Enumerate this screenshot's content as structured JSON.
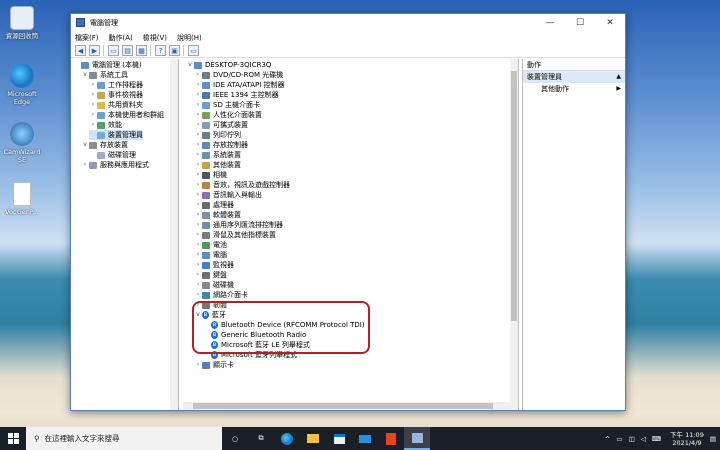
{
  "desktop": {
    "icons": [
      {
        "label": "資源回收筒",
        "icon": "recycle-bin"
      },
      {
        "label": "Microsoft Edge",
        "icon": "edge"
      },
      {
        "label": "CamWizard SE",
        "icon": "camwizard"
      },
      {
        "label": "VocGenP...",
        "icon": "file"
      }
    ]
  },
  "window": {
    "title": "電腦管理",
    "menu": [
      "檔案(F)",
      "動作(A)",
      "檢視(V)",
      "說明(H)"
    ],
    "controls": {
      "minimize": "—",
      "maximize": "☐",
      "close": "✕"
    }
  },
  "left_tree": [
    {
      "label": "電腦管理 (本機)",
      "level": 0,
      "chev": "",
      "icon": "computer"
    },
    {
      "label": "系統工具",
      "level": 1,
      "chev": "v",
      "icon": "tools"
    },
    {
      "label": "工作排程器",
      "level": 2,
      "chev": ">",
      "icon": "scheduler"
    },
    {
      "label": "事件檢視器",
      "level": 2,
      "chev": ">",
      "icon": "event"
    },
    {
      "label": "共用資料夾",
      "level": 2,
      "chev": ">",
      "icon": "folder"
    },
    {
      "label": "本機使用者和群組",
      "level": 2,
      "chev": ">",
      "icon": "users"
    },
    {
      "label": "效能",
      "level": 2,
      "chev": ">",
      "icon": "performance"
    },
    {
      "label": "裝置管理員",
      "level": 2,
      "chev": "",
      "icon": "device",
      "selected": true
    },
    {
      "label": "存放裝置",
      "level": 1,
      "chev": "v",
      "icon": "storage"
    },
    {
      "label": "磁碟管理",
      "level": 2,
      "chev": "",
      "icon": "disk"
    },
    {
      "label": "服務與應用程式",
      "level": 1,
      "chev": ">",
      "icon": "services"
    }
  ],
  "device_tree": {
    "root": "DESKTOP-3QICR3Q",
    "categories": [
      "DVD/CD-ROM 光碟機",
      "IDE ATA/ATAPI 控制器",
      "IEEE 1394 主控制器",
      "SD 主機介面卡",
      "人性化介面裝置",
      "可攜式裝置",
      "列印佇列",
      "存放控制器",
      "系統裝置",
      "其他裝置",
      "相機",
      "音效，視訊及遊戲控制器",
      "音訊輸入與輸出",
      "處理器",
      "軟體裝置",
      "通用序列匯流排控制器",
      "滑鼠及其他指標裝置",
      "電池",
      "電腦",
      "監視器",
      "鍵盤",
      "磁碟機",
      "網路介面卡",
      "韌體"
    ],
    "bluetooth": {
      "label": "藍牙",
      "children": [
        "Bluetooth Device (RFCOMM Protocol TDI)",
        "Generic Bluetooth Radio",
        "Microsoft 藍牙 LE 列舉程式",
        "Microsoft 藍牙列舉程式"
      ]
    },
    "after": [
      "顯示卡"
    ]
  },
  "actions": {
    "header": "動作",
    "section": "裝置管理員",
    "items": [
      "其他動作"
    ]
  },
  "taskbar": {
    "search_placeholder": "在這裡輸入文字來搜尋",
    "time": "下午 11:09",
    "date": "2021/4/9"
  },
  "colors": {
    "accent": "#1f6fd1",
    "highlight_border": "#b4202a",
    "selected": "#cde3f7"
  }
}
